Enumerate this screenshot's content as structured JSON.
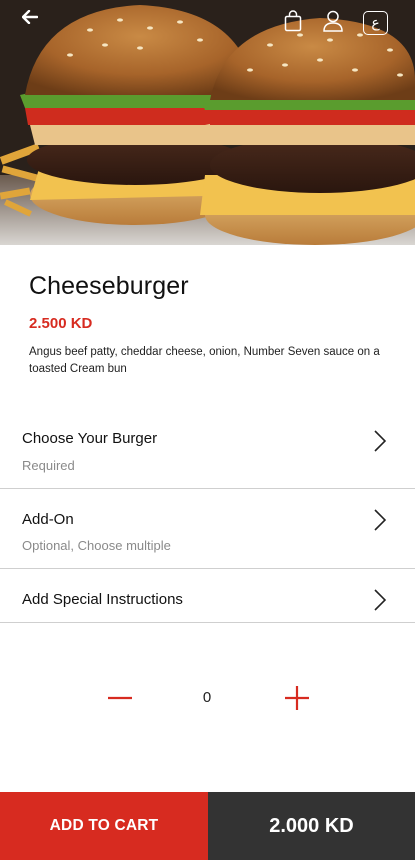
{
  "header": {
    "back_icon": "back-arrow-icon",
    "cart_icon": "shopping-bag-icon",
    "account_icon": "user-icon",
    "language_label": "ع"
  },
  "product": {
    "name": "Cheeseburger",
    "price": "2.500 KD",
    "description": "Angus beef patty, cheddar cheese, onion, Number Seven sauce on a toasted Cream bun"
  },
  "options": [
    {
      "title": "Choose Your Burger",
      "subtitle": "Required"
    },
    {
      "title": "Add-On",
      "subtitle": "Optional, Choose multiple"
    },
    {
      "title": "Add Special Instructions",
      "subtitle": ""
    }
  ],
  "quantity": {
    "value": "0",
    "decrease_icon": "minus-icon",
    "increase_icon": "plus-icon"
  },
  "footer": {
    "add_to_cart_label": "ADD TO CART",
    "total": "2.000 KD"
  },
  "colors": {
    "accent": "#d72b20",
    "footer_dark": "#333333",
    "divider": "#cfcfcf"
  }
}
